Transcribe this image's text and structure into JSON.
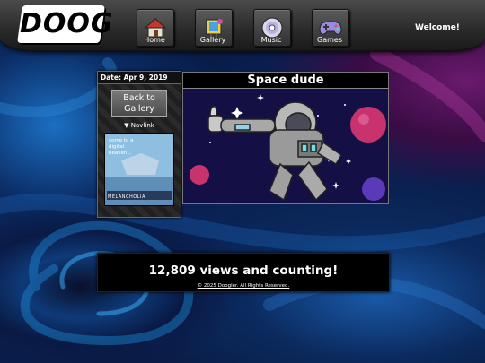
{
  "header": {
    "logo_text": "DOOG",
    "welcome": "Welcome!",
    "nav": [
      {
        "label": "Home",
        "icon": "house-icon"
      },
      {
        "label": "Gallery",
        "icon": "gallery-icon"
      },
      {
        "label": "Music",
        "icon": "cd-icon"
      },
      {
        "label": "Games",
        "icon": "gamepad-icon"
      }
    ]
  },
  "sidebar": {
    "date": "Date: Apr 9, 2019",
    "back_label": "Back to Gallery",
    "navlink": "▼ Navlink",
    "thumb_text": "come to a digital heaven...",
    "thumb_brand": "MELANCHOLIA"
  },
  "artwork": {
    "title": "Space dude"
  },
  "footer": {
    "views": "12,809 views and counting!",
    "copyright": "© 2025 Doogler. All Rights Reserved."
  },
  "colors": {
    "accent_pink": "#c8336e",
    "header_gray": "#3a3a3a",
    "space_bg": "#0e0d3a"
  }
}
